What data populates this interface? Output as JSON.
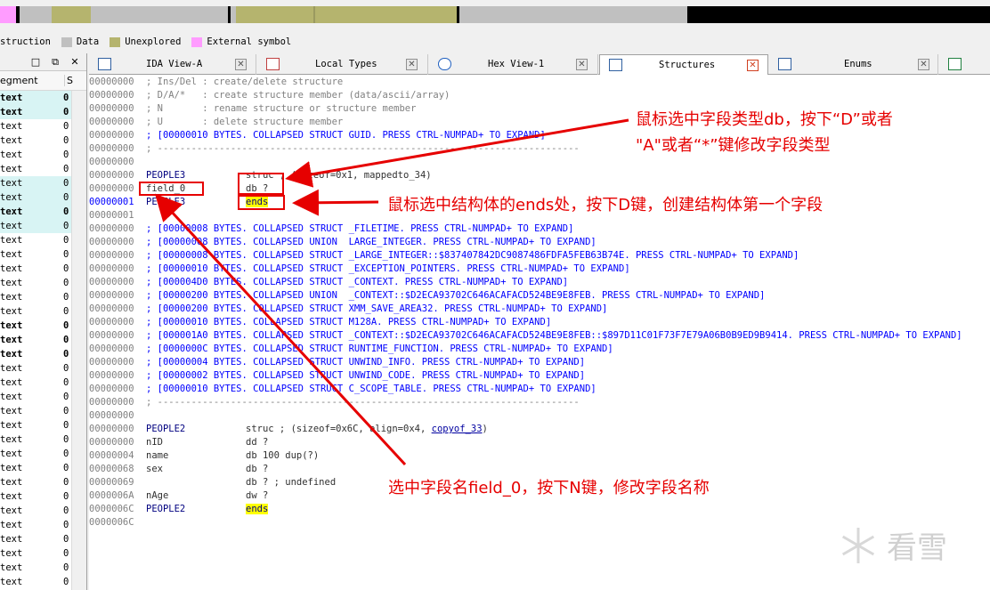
{
  "legend": [
    {
      "label": "struction",
      "color": ""
    },
    {
      "label": "Data",
      "color": "#c0c0c0"
    },
    {
      "label": "Unexplored",
      "color": "#b5b46e"
    },
    {
      "label": "External symbol",
      "color": "#ff9cff"
    }
  ],
  "left_panel": {
    "header_col1": "egment",
    "header_col2": "S",
    "rows": [
      {
        "c1": "text",
        "c2": "0",
        "hl": true,
        "bold": true
      },
      {
        "c1": "text",
        "c2": "0",
        "hl": true,
        "bold": true
      },
      {
        "c1": "text",
        "c2": "0",
        "hl": false,
        "bold": false
      },
      {
        "c1": "text",
        "c2": "0",
        "hl": false,
        "bold": false
      },
      {
        "c1": "text",
        "c2": "0",
        "hl": false,
        "bold": false
      },
      {
        "c1": "text",
        "c2": "0",
        "hl": false,
        "bold": false
      },
      {
        "c1": "text",
        "c2": "0",
        "hl": true,
        "bold": false
      },
      {
        "c1": "text",
        "c2": "0",
        "hl": true,
        "bold": false
      },
      {
        "c1": "text",
        "c2": "0",
        "hl": true,
        "bold": true
      },
      {
        "c1": "text",
        "c2": "0",
        "hl": true,
        "bold": false
      },
      {
        "c1": "text",
        "c2": "0",
        "hl": false,
        "bold": false
      },
      {
        "c1": "text",
        "c2": "0",
        "hl": false,
        "bold": false
      },
      {
        "c1": "text",
        "c2": "0",
        "hl": false,
        "bold": false
      },
      {
        "c1": "text",
        "c2": "0",
        "hl": false,
        "bold": false
      },
      {
        "c1": "text",
        "c2": "0",
        "hl": false,
        "bold": false
      },
      {
        "c1": "text",
        "c2": "0",
        "hl": false,
        "bold": false
      },
      {
        "c1": "text",
        "c2": "0",
        "hl": false,
        "bold": true
      },
      {
        "c1": "text",
        "c2": "0",
        "hl": false,
        "bold": true
      },
      {
        "c1": "text",
        "c2": "0",
        "hl": false,
        "bold": true
      },
      {
        "c1": "text",
        "c2": "0",
        "hl": false,
        "bold": false
      },
      {
        "c1": "text",
        "c2": "0",
        "hl": false,
        "bold": false
      },
      {
        "c1": "text",
        "c2": "0",
        "hl": false,
        "bold": false
      },
      {
        "c1": "text",
        "c2": "0",
        "hl": false,
        "bold": false
      },
      {
        "c1": "text",
        "c2": "0",
        "hl": false,
        "bold": false
      },
      {
        "c1": "text",
        "c2": "0",
        "hl": false,
        "bold": false
      },
      {
        "c1": "text",
        "c2": "0",
        "hl": false,
        "bold": false
      },
      {
        "c1": "text",
        "c2": "0",
        "hl": false,
        "bold": false
      },
      {
        "c1": "text",
        "c2": "0",
        "hl": false,
        "bold": false
      },
      {
        "c1": "text",
        "c2": "0",
        "hl": false,
        "bold": false
      },
      {
        "c1": "text",
        "c2": "0",
        "hl": false,
        "bold": false
      },
      {
        "c1": "text",
        "c2": "0",
        "hl": false,
        "bold": false
      },
      {
        "c1": "text",
        "c2": "0",
        "hl": false,
        "bold": false
      },
      {
        "c1": "text",
        "c2": "0",
        "hl": false,
        "bold": false
      },
      {
        "c1": "text",
        "c2": "0",
        "hl": false,
        "bold": false
      },
      {
        "c1": "text",
        "c2": "0",
        "hl": false,
        "bold": false
      },
      {
        "c1": "text",
        "c2": "0",
        "hl": false,
        "bold": false
      }
    ]
  },
  "tabs": [
    {
      "label": "IDA View-A",
      "active": false
    },
    {
      "label": "Local Types",
      "active": false
    },
    {
      "label": "Hex View-1",
      "active": false
    },
    {
      "label": "Structures",
      "active": true
    },
    {
      "label": "Enums",
      "active": false
    }
  ],
  "listing": [
    {
      "addr": "00000000",
      "text": "; Ins/Del : create/delete structure",
      "cls": "gray"
    },
    {
      "addr": "00000000",
      "text": "; D/A/*   : create structure member (data/ascii/array)",
      "cls": "gray"
    },
    {
      "addr": "00000000",
      "text": "; N       : rename structure or structure member",
      "cls": "gray"
    },
    {
      "addr": "00000000",
      "text": "; U       : delete structure member",
      "cls": "gray"
    },
    {
      "addr": "00000000",
      "text": "; [00000010 BYTES. COLLAPSED STRUCT GUID. PRESS CTRL-NUMPAD+ TO EXPAND]",
      "cls": "blue"
    },
    {
      "addr": "00000000",
      "text": "; ---------------------------------------------------------------------------",
      "cls": "gray"
    },
    {
      "addr": "00000000",
      "text": "",
      "cls": "gray"
    },
    {
      "addr": "00000000",
      "name": "PEOPLE3",
      "rest": "struc ; (sizeof=0x1, mappedto_34)",
      "kind": "struc"
    },
    {
      "addr": "00000000",
      "name": "field_0",
      "rest": "db ?",
      "kind": "member"
    },
    {
      "addr": "00000001",
      "name": "PEOPLE3",
      "rest": "ends",
      "kind": "ends",
      "addrblue": true
    },
    {
      "addr": "00000001",
      "text": "",
      "cls": "gray"
    },
    {
      "addr": "00000000",
      "text": "; [00000008 BYTES. COLLAPSED STRUCT _FILETIME. PRESS CTRL-NUMPAD+ TO EXPAND]",
      "cls": "blue"
    },
    {
      "addr": "00000000",
      "text": "; [00000008 BYTES. COLLAPSED UNION  LARGE_INTEGER. PRESS CTRL-NUMPAD+ TO EXPAND]",
      "cls": "blue"
    },
    {
      "addr": "00000000",
      "text": "; [00000008 BYTES. COLLAPSED STRUCT _LARGE_INTEGER::$837407842DC9087486FDFA5FEB63B74E. PRESS CTRL-NUMPAD+ TO EXPAND]",
      "cls": "blue"
    },
    {
      "addr": "00000000",
      "text": "; [00000010 BYTES. COLLAPSED STRUCT _EXCEPTION_POINTERS. PRESS CTRL-NUMPAD+ TO EXPAND]",
      "cls": "blue"
    },
    {
      "addr": "00000000",
      "text": "; [000004D0 BYTES. COLLAPSED STRUCT _CONTEXT. PRESS CTRL-NUMPAD+ TO EXPAND]",
      "cls": "blue"
    },
    {
      "addr": "00000000",
      "text": "; [00000200 BYTES. COLLAPSED UNION  _CONTEXT::$D2ECA93702C646ACAFACD524BE9E8FEB. PRESS CTRL-NUMPAD+ TO EXPAND]",
      "cls": "blue"
    },
    {
      "addr": "00000000",
      "text": "; [00000200 BYTES. COLLAPSED STRUCT XMM_SAVE_AREA32. PRESS CTRL-NUMPAD+ TO EXPAND]",
      "cls": "blue"
    },
    {
      "addr": "00000000",
      "text": "; [00000010 BYTES. COLLAPSED STRUCT M128A. PRESS CTRL-NUMPAD+ TO EXPAND]",
      "cls": "blue"
    },
    {
      "addr": "00000000",
      "text": "; [000001A0 BYTES. COLLAPSED STRUCT _CONTEXT::$D2ECA93702C646ACAFACD524BE9E8FEB::$897D11C01F73F7E79A06B0B9ED9B9414. PRESS CTRL-NUMPAD+ TO EXPAND]",
      "cls": "blue"
    },
    {
      "addr": "00000000",
      "text": "; [0000000C BYTES. COLLAPSED STRUCT RUNTIME_FUNCTION. PRESS CTRL-NUMPAD+ TO EXPAND]",
      "cls": "blue"
    },
    {
      "addr": "00000000",
      "text": "; [00000004 BYTES. COLLAPSED STRUCT UNWIND_INFO. PRESS CTRL-NUMPAD+ TO EXPAND]",
      "cls": "blue"
    },
    {
      "addr": "00000000",
      "text": "; [00000002 BYTES. COLLAPSED STRUCT UNWIND_CODE. PRESS CTRL-NUMPAD+ TO EXPAND]",
      "cls": "blue"
    },
    {
      "addr": "00000000",
      "text": "; [00000010 BYTES. COLLAPSED STRUCT C_SCOPE_TABLE. PRESS CTRL-NUMPAD+ TO EXPAND]",
      "cls": "blue"
    },
    {
      "addr": "00000000",
      "text": "; ---------------------------------------------------------------------------",
      "cls": "gray"
    },
    {
      "addr": "00000000",
      "text": "",
      "cls": "gray"
    },
    {
      "addr": "00000000",
      "name": "PEOPLE2",
      "rest": "struc ; (sizeof=0x6C, align=0x4, ",
      "link": "copyof_33",
      "tail": ")",
      "kind": "struc"
    },
    {
      "addr": "00000000",
      "name": "nID",
      "rest": "dd ?",
      "kind": "member"
    },
    {
      "addr": "00000004",
      "name": "name",
      "rest": "db 100 dup(?)",
      "kind": "member"
    },
    {
      "addr": "00000068",
      "name": "sex",
      "rest": "db ?",
      "kind": "member"
    },
    {
      "addr": "00000069",
      "name": "",
      "rest": "db ? ; undefined",
      "kind": "member"
    },
    {
      "addr": "0000006A",
      "name": "nAge",
      "rest": "dw ?",
      "kind": "member"
    },
    {
      "addr": "0000006C",
      "name": "PEOPLE2",
      "rest": "ends",
      "kind": "ends"
    },
    {
      "addr": "0000006C",
      "text": "",
      "cls": "gray"
    }
  ],
  "annotations": {
    "a1_line1": "鼠标选中字段类型db，按下“D”或者",
    "a1_line2": "\"A\"或者“*”键修改字段类型",
    "a2": "鼠标选中结构体的ends处，按下D键，创建结构体第一个字段",
    "a3": "选中字段名field_0，按下N键，修改字段名称"
  },
  "watermark": "看雪",
  "colors": {
    "annotation": "#e60000",
    "ends_highlight": "#ffff00",
    "comment_blue": "#0000ff",
    "unexplored": "#b5b46e"
  }
}
